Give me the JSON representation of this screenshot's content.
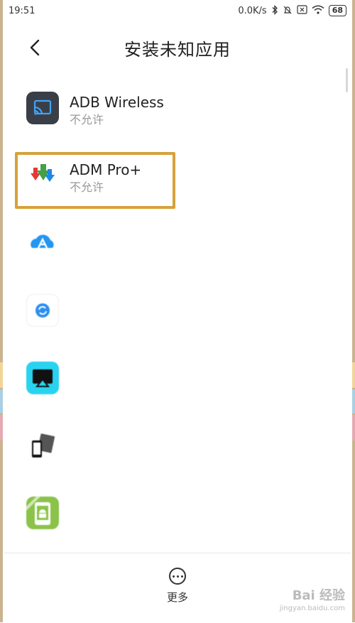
{
  "status_bar": {
    "time": "19:51",
    "network_speed": "0.0K/s",
    "icons": [
      "bluetooth-icon",
      "mute-icon",
      "no-sim-icon",
      "wifi-icon"
    ],
    "battery": "68"
  },
  "header": {
    "title": "安装未知应用",
    "back_icon": "chevron-left-icon"
  },
  "apps": [
    {
      "name": "ADB Wireless",
      "status": "不允许",
      "icon": "cast-icon"
    },
    {
      "name": "ADM Pro+",
      "status": "不允许",
      "icon": "download-arrows-icon",
      "highlighted": true
    },
    {
      "name": "",
      "status": "",
      "icon": "cloud-a-icon",
      "blurred": true
    },
    {
      "name": "",
      "status": "",
      "icon": "sync-icon",
      "blurred": true
    },
    {
      "name": "",
      "status": "",
      "icon": "airplay-icon",
      "blurred": true
    },
    {
      "name": "",
      "status": "",
      "icon": "mirror-icon",
      "blurred": true
    },
    {
      "name": "",
      "status": "",
      "icon": "android-cast-icon",
      "blurred": true
    }
  ],
  "bottom_bar": {
    "more_label": "更多",
    "more_icon": "more-dots-icon"
  },
  "watermark": {
    "text": "Bai 经验",
    "sub": "jingyan.baidu.com"
  },
  "colors": {
    "highlight": "#d7a13a",
    "frame": "#c9b48f"
  }
}
